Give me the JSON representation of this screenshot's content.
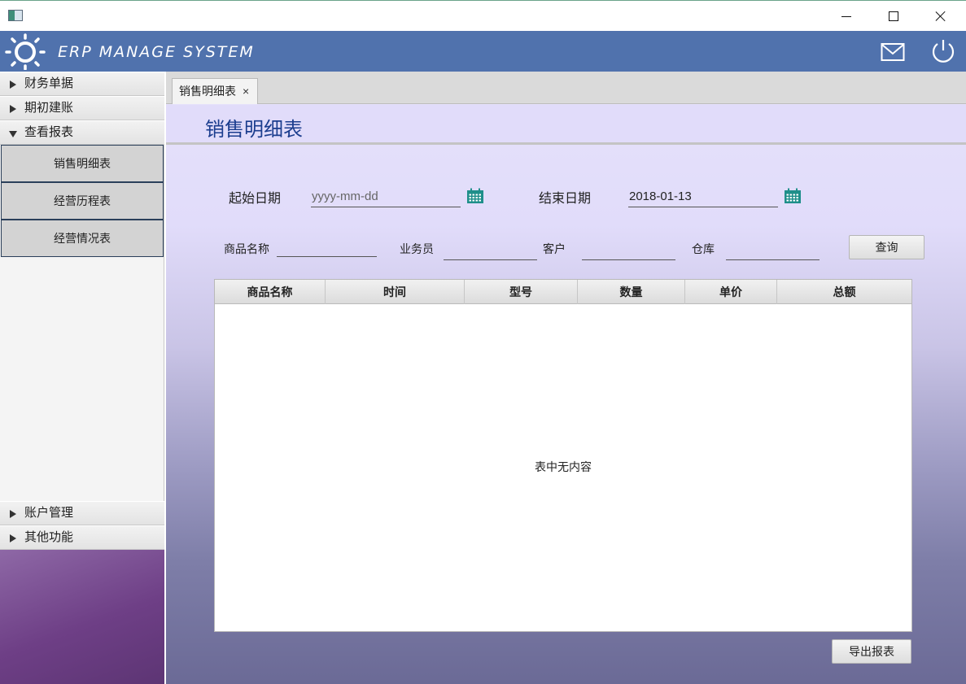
{
  "window": {
    "minimize_icon": "minimize-icon",
    "maximize_icon": "maximize-icon",
    "close_icon": "close-icon"
  },
  "header": {
    "title": "ERP MANAGE SYSTEM",
    "logo_icon": "sun-icon",
    "mail_icon": "mail-icon",
    "power_icon": "power-icon",
    "background_color": "#5072ad"
  },
  "sidebar": {
    "groups_top": [
      {
        "label": "财务单据",
        "expanded": false
      },
      {
        "label": "期初建账",
        "expanded": false
      },
      {
        "label": "查看报表",
        "expanded": true
      }
    ],
    "report_items": [
      {
        "label": "销售明细表"
      },
      {
        "label": "经营历程表"
      },
      {
        "label": "经营情况表"
      }
    ],
    "groups_bottom": [
      {
        "label": "账户管理",
        "expanded": false
      },
      {
        "label": "其他功能",
        "expanded": false
      }
    ]
  },
  "tabs": [
    {
      "label": "销售明细表",
      "close": "×"
    }
  ],
  "page": {
    "title": "销售明细表",
    "title_color": "#1b3d8e"
  },
  "form": {
    "start_date_label": "起始日期",
    "start_date_placeholder": "yyyy-mm-dd",
    "start_date_value": "",
    "end_date_label": "结束日期",
    "end_date_value": "2018-01-13",
    "product_label": "商品名称",
    "salesperson_label": "业务员",
    "customer_label": "客户",
    "warehouse_label": "仓库",
    "query_button": "查询",
    "calendar_icon": "calendar-icon",
    "accent_color": "#1f8f8a"
  },
  "table": {
    "columns": [
      "商品名称",
      "时间",
      "型号",
      "数量",
      "单价",
      "总额"
    ],
    "rows": [],
    "empty_message": "表中无内容"
  },
  "export_button": "导出报表"
}
